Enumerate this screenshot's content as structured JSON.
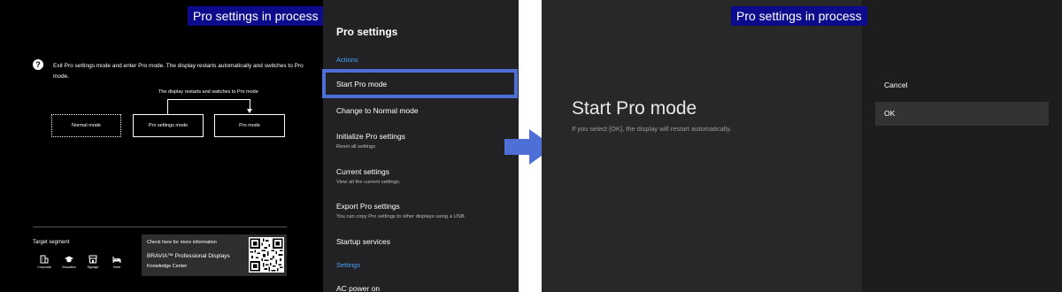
{
  "banner_text": "Pro settings in process",
  "left_info": {
    "description": "Exit Pro settings mode and enter Pro mode. The display restarts automatically and switches to Pro mode.",
    "flow_label": "The display restarts and switches to Pro mode",
    "modes": [
      "Normal mode",
      "Pro settings mode",
      "Pro mode"
    ],
    "target_segment_title": "Target segment",
    "segments": [
      {
        "label": "Corporate",
        "icon": "building-icon"
      },
      {
        "label": "Education",
        "icon": "graduation-cap-icon"
      },
      {
        "label": "Signage",
        "icon": "storefront-icon"
      },
      {
        "label": "Hotel",
        "icon": "bed-icon"
      }
    ],
    "info_card": {
      "check_text": "Check here for more information",
      "brand": "BRAVIA™ Professional Displays",
      "knowledge": "Knowledge Center"
    }
  },
  "menu": {
    "title": "Pro settings",
    "sections": {
      "actions": "Actions",
      "settings": "Settings"
    },
    "items": [
      {
        "label": "Start Pro mode",
        "sub": ""
      },
      {
        "label": "Change to Normal mode",
        "sub": ""
      },
      {
        "label": "Initialize Pro settings",
        "sub": "Reset all settings"
      },
      {
        "label": "Current settings",
        "sub": "View all the current settings."
      },
      {
        "label": "Export Pro settings",
        "sub": "You can copy Pro settings to other displays using a USB."
      },
      {
        "label": "Startup services",
        "sub": ""
      },
      {
        "label": "AC power on",
        "sub": ""
      }
    ],
    "selected_index": 0
  },
  "dialog": {
    "title": "Start Pro mode",
    "text": "If you select [OK], the display will restart automatically.",
    "options": [
      "Cancel",
      "OK"
    ],
    "focused_option": "OK"
  },
  "colors": {
    "banner_bg": "#0b0b8c",
    "highlight": "#4e6fd6",
    "section_blue": "#4aa3ff",
    "arrow": "#4e6fd6"
  }
}
